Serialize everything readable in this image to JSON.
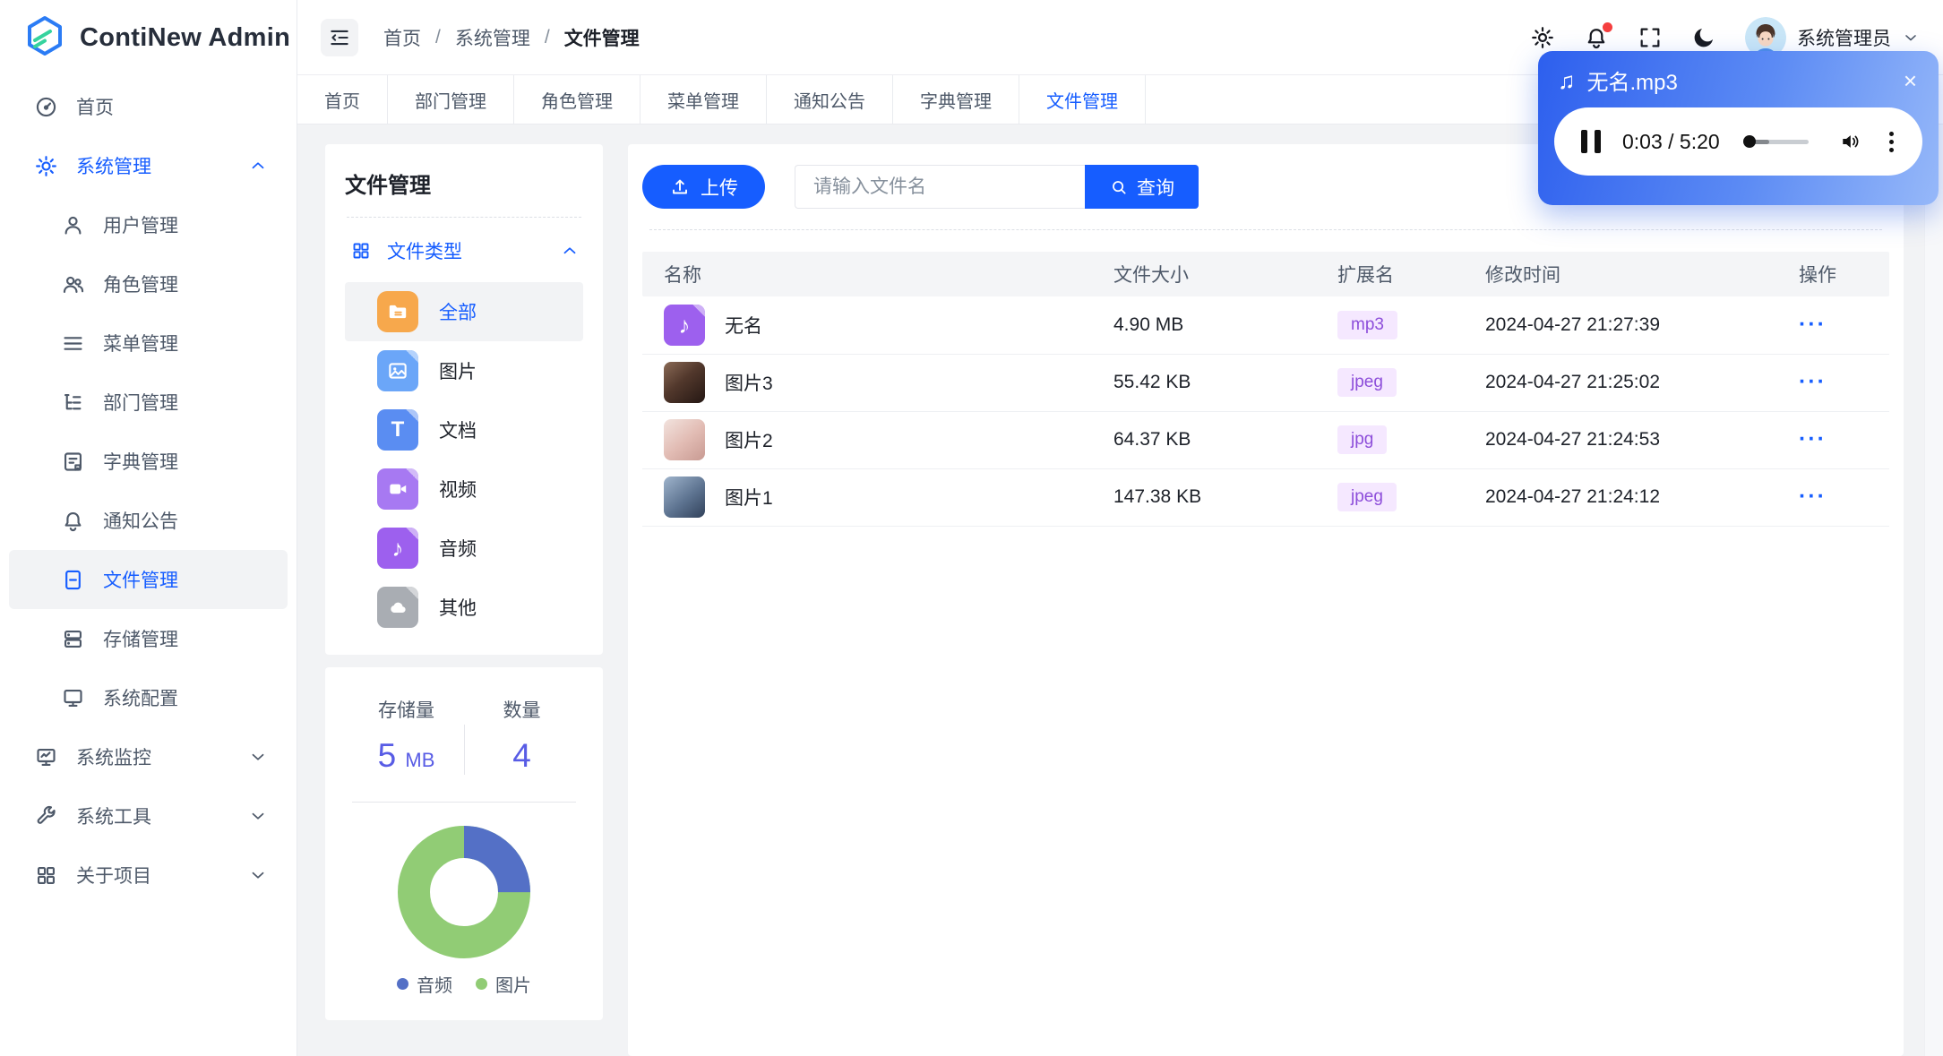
{
  "app": {
    "title": "ContiNew Admin"
  },
  "colors": {
    "primary": "#165DFF",
    "stat_value": "#585ce5",
    "badge_bg": "#f5e8ff",
    "badge_text": "#8d4eda",
    "audio_gradient": [
      "#2d5fee",
      "#96b8f9"
    ],
    "notification_dot": "#f53f3f"
  },
  "topbar": {
    "breadcrumb": {
      "items": [
        "首页",
        "系统管理",
        "文件管理"
      ],
      "separator": "/"
    },
    "user": {
      "name": "系统管理员"
    },
    "icons": [
      "settings",
      "notification-bell",
      "fullscreen",
      "dark-mode-moon",
      "avatar"
    ]
  },
  "tabs": {
    "items": [
      "首页",
      "部门管理",
      "角色管理",
      "菜单管理",
      "通知公告",
      "字典管理",
      "文件管理"
    ],
    "active": "文件管理"
  },
  "sidebar": {
    "items": [
      {
        "label": "首页",
        "icon": "dashboard"
      },
      {
        "label": "系统管理",
        "icon": "gear",
        "expanded": true
      },
      {
        "label": "用户管理",
        "icon": "user"
      },
      {
        "label": "角色管理",
        "icon": "users"
      },
      {
        "label": "菜单管理",
        "icon": "menu-lines"
      },
      {
        "label": "部门管理",
        "icon": "tree-list"
      },
      {
        "label": "字典管理",
        "icon": "dictionary"
      },
      {
        "label": "通知公告",
        "icon": "bell"
      },
      {
        "label": "文件管理",
        "icon": "file",
        "active": true
      },
      {
        "label": "存储管理",
        "icon": "server"
      },
      {
        "label": "系统配置",
        "icon": "monitor"
      },
      {
        "label": "系统监控",
        "icon": "monitor-chart",
        "collapsed": true
      },
      {
        "label": "系统工具",
        "icon": "wrench",
        "collapsed": true
      },
      {
        "label": "关于项目",
        "icon": "grid",
        "collapsed": true
      }
    ]
  },
  "left_panel": {
    "title": "文件管理",
    "section": "文件类型",
    "types": [
      {
        "label": "全部",
        "icon": "folder-orange",
        "active": true
      },
      {
        "label": "图片",
        "icon": "file-image-blue"
      },
      {
        "label": "文档",
        "icon": "file-doc-blue"
      },
      {
        "label": "视频",
        "icon": "file-video-purple"
      },
      {
        "label": "音频",
        "icon": "file-audio-violet"
      },
      {
        "label": "其他",
        "icon": "file-other-gray"
      }
    ],
    "stats": {
      "storage_label": "存储量",
      "storage_value": "5",
      "storage_unit": "MB",
      "count_label": "数量",
      "count_value": "4"
    },
    "legend": [
      {
        "label": "音频",
        "color": "#5470c6"
      },
      {
        "label": "图片",
        "color": "#91cc75"
      }
    ]
  },
  "chart_data": {
    "type": "pie",
    "donut": true,
    "labels": [
      "音频",
      "图片"
    ],
    "values": [
      25,
      75
    ],
    "colors": [
      "#5470c6",
      "#91cc75"
    ],
    "legend_position": "bottom"
  },
  "toolbar": {
    "upload_label": "上传",
    "search_placeholder": "请输入文件名",
    "query_label": "查询"
  },
  "table": {
    "headers": [
      "名称",
      "文件大小",
      "扩展名",
      "修改时间",
      "操作"
    ],
    "ops_label": "···",
    "rows": [
      {
        "name": "无名",
        "size": "4.90 MB",
        "ext": "mp3",
        "time": "2024-04-27 21:27:39",
        "thumb": "audio-file-icon"
      },
      {
        "name": "图片3",
        "size": "55.42 KB",
        "ext": "jpeg",
        "time": "2024-04-27 21:25:02",
        "thumb": "photo-portrait-dark"
      },
      {
        "name": "图片2",
        "size": "64.37 KB",
        "ext": "jpg",
        "time": "2024-04-27 21:24:53",
        "thumb": "photo-portrait-light"
      },
      {
        "name": "图片1",
        "size": "147.38 KB",
        "ext": "jpeg",
        "time": "2024-04-27 21:24:12",
        "thumb": "photo-portrait-blue"
      }
    ]
  },
  "audio_player": {
    "title": "无名.mp3",
    "note_icon": "♫",
    "time": "0:03 / 5:20",
    "close": "×"
  }
}
